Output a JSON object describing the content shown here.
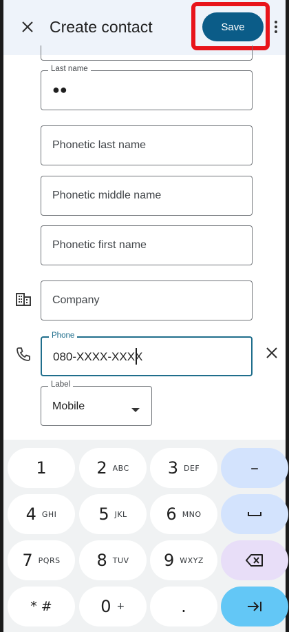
{
  "header": {
    "title": "Create contact",
    "save_label": "Save"
  },
  "form": {
    "last_name": {
      "label": "Last name",
      "value": "●●"
    },
    "phonetic_last_name": {
      "placeholder": "Phonetic last name"
    },
    "phonetic_middle_name": {
      "placeholder": "Phonetic middle name"
    },
    "phonetic_first_name": {
      "placeholder": "Phonetic first name"
    },
    "company": {
      "placeholder": "Company"
    },
    "phone": {
      "label": "Phone",
      "value": "080-XXXX-XXXX"
    },
    "phone_label_select": {
      "label": "Label",
      "value": "Mobile"
    }
  },
  "keyboard": {
    "rows": [
      [
        {
          "main": "1",
          "sub": ""
        },
        {
          "main": "2",
          "sub": "ABC"
        },
        {
          "main": "3",
          "sub": "DEF"
        },
        {
          "main": "–",
          "sub": ""
        }
      ],
      [
        {
          "main": "4",
          "sub": "GHI"
        },
        {
          "main": "5",
          "sub": "JKL"
        },
        {
          "main": "6",
          "sub": "MNO"
        },
        {
          "main": "␣",
          "sub": ""
        }
      ],
      [
        {
          "main": "7",
          "sub": "PQRS"
        },
        {
          "main": "8",
          "sub": "TUV"
        },
        {
          "main": "9",
          "sub": "WXYZ"
        },
        {
          "main": "⌫",
          "sub": ""
        }
      ],
      [
        {
          "main": "* #",
          "sub": ""
        },
        {
          "main": "0",
          "sub": "+"
        },
        {
          "main": ".",
          "sub": ""
        },
        {
          "main": "→|",
          "sub": ""
        }
      ]
    ]
  },
  "colors": {
    "accent": "#0b5c88",
    "highlight": "#e8141b",
    "focus_border": "#1f6e8c"
  }
}
